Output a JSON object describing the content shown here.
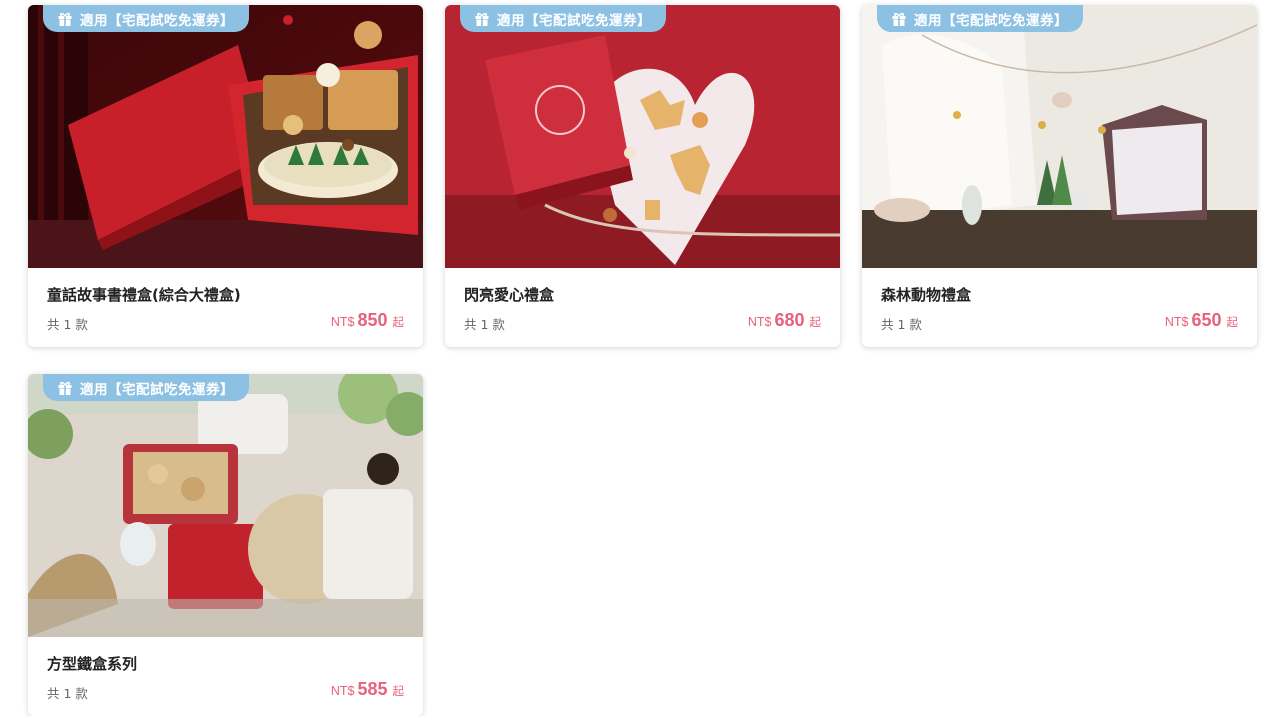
{
  "products": [
    {
      "badge": "適用【宅配試吃免運券】",
      "title": "童話故事書禮盒(綜合大禮盒)",
      "count": "共 1 款",
      "currency": "NT$",
      "price": "850",
      "suffix": "起",
      "image": "red-storybook-gift-box-with-cookies"
    },
    {
      "badge": "適用【宅配試吃免運券】",
      "title": "閃亮愛心禮盒",
      "count": "共 1 款",
      "currency": "NT$",
      "price": "680",
      "suffix": "起",
      "image": "red-box-with-heart-and-cookies"
    },
    {
      "badge": "適用【宅配試吃免運券】",
      "title": "森林動物禮盒",
      "count": "共 1 款",
      "currency": "NT$",
      "price": "650",
      "suffix": "起",
      "image": "forest-animal-gift-box-scene"
    },
    {
      "badge": "適用【宅配試吃免運券】",
      "title": "方型鐵盒系列",
      "count": "共 1 款",
      "currency": "NT$",
      "price": "585",
      "suffix": "起",
      "image": "square-tin-box-picnic-scene"
    }
  ],
  "icons": {
    "badge_icon": "gift-icon"
  },
  "colors": {
    "badge": "#8cc1e4",
    "price": "#e8617a",
    "title": "#222222"
  }
}
